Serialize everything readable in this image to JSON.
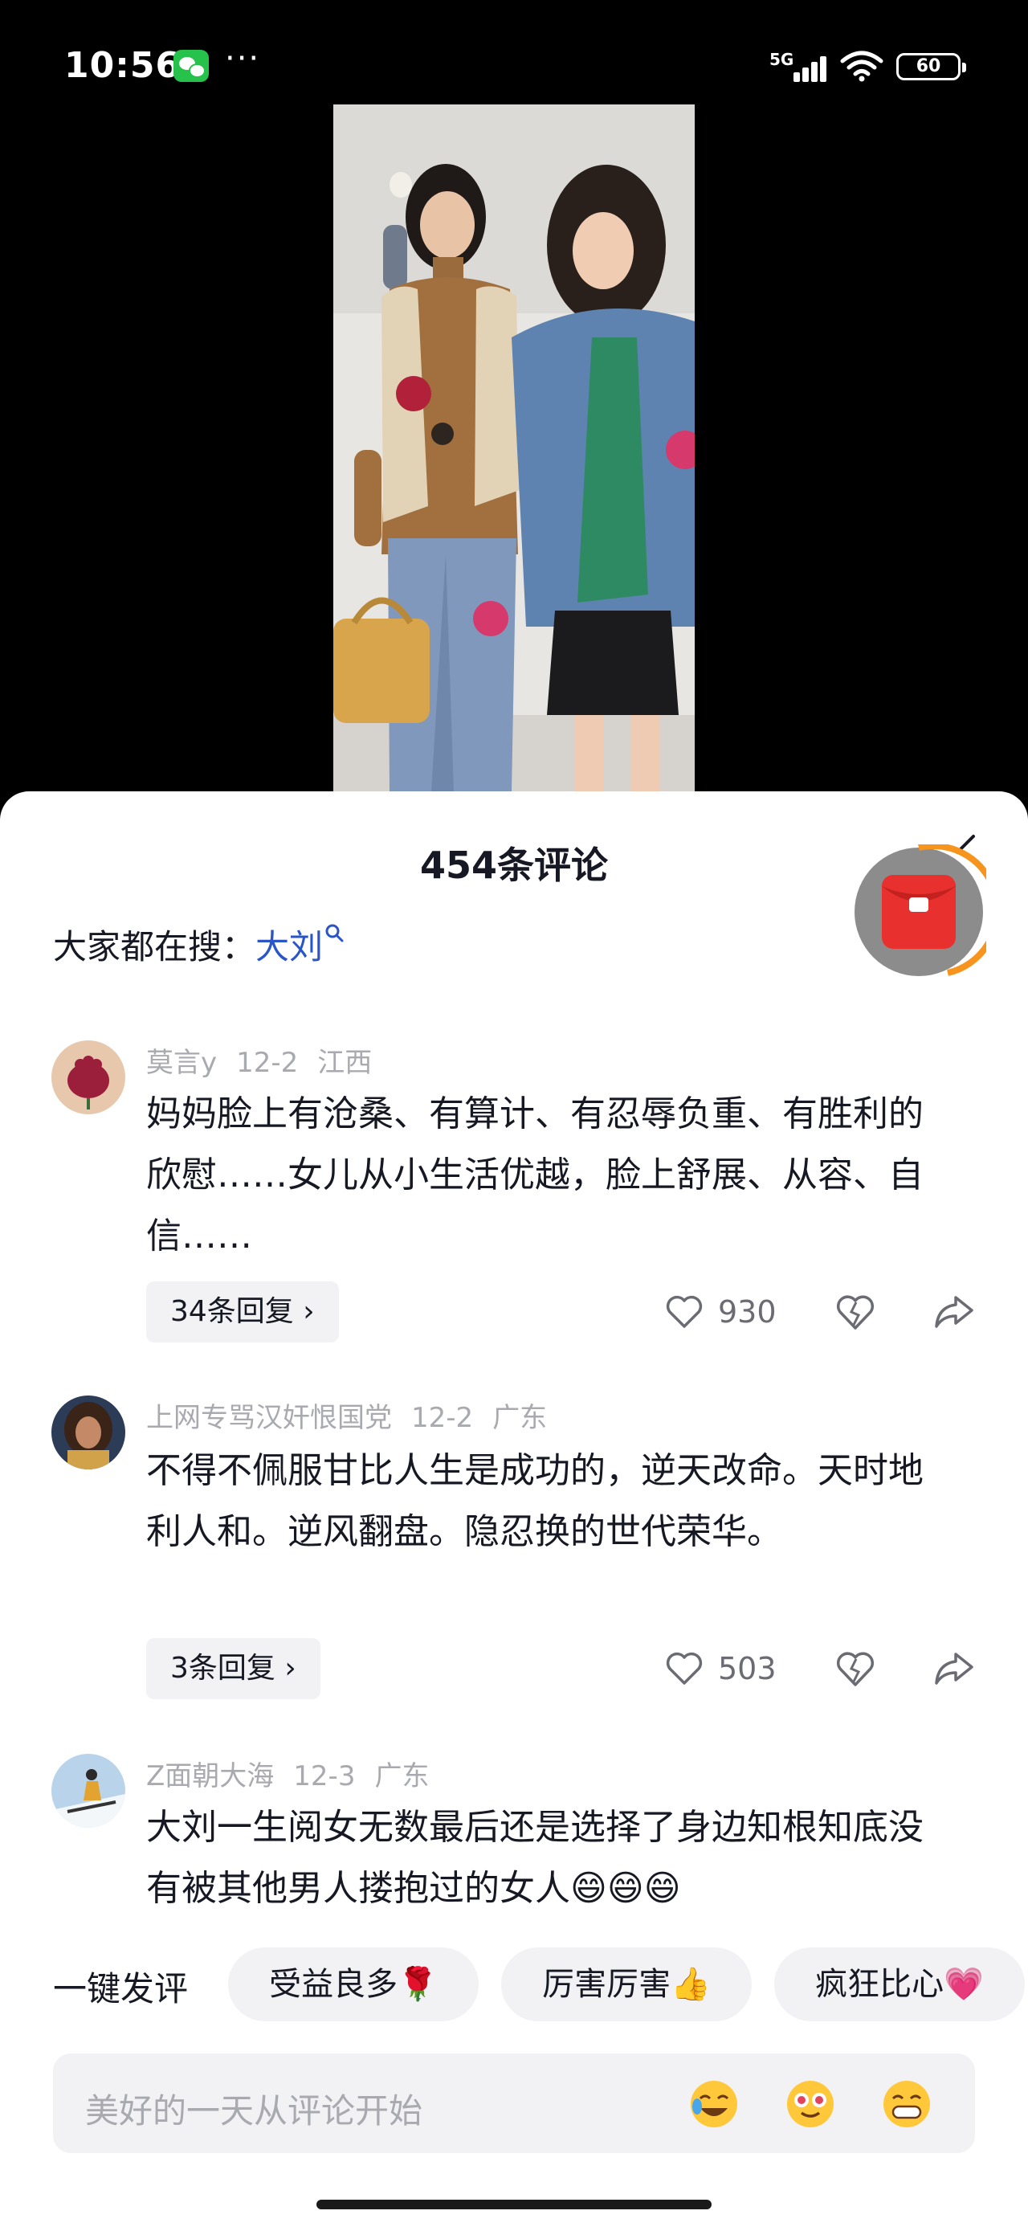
{
  "status_bar": {
    "time": "10:56",
    "dots": "···",
    "network": "5G",
    "battery": "60"
  },
  "comments_panel": {
    "title": "454条评论",
    "search_prefix": "大家都在搜：",
    "search_term": "大刘"
  },
  "comments": [
    {
      "user": "莫言y",
      "date": "12-2",
      "location": "江西",
      "text": "妈妈脸上有沧桑、有算计、有忍辱负重、有胜利的欣慰……女儿从小生活优越，脸上舒展、从容、自信……",
      "replies": "34条回复",
      "likes": "930"
    },
    {
      "user": "上网专骂汉奸恨国党",
      "date": "12-2",
      "location": "广东",
      "text": "不得不佩服甘比人生是成功的，逆天改命。天时地利人和。逆风翻盘。隐忍换的世代荣华。",
      "replies": "3条回复",
      "likes": "503"
    },
    {
      "user": "Z面朝大海",
      "date": "12-3",
      "location": "广东",
      "text": "大刘一生阅女无数最后还是选择了身边知根知底没有被其他男人搂抱过的女人"
    }
  ],
  "quick_reply": {
    "label": "一键发评",
    "chips": [
      "受益良多🌹",
      "厉害厉害👍",
      "疯狂比心💗"
    ]
  },
  "input": {
    "placeholder": "美好的一天从评论开始"
  },
  "colors": {
    "link": "#2a55c7",
    "accent_orange": "#f7941d",
    "red_packet": "#e8312f",
    "meta_gray": "#a9aab0"
  }
}
